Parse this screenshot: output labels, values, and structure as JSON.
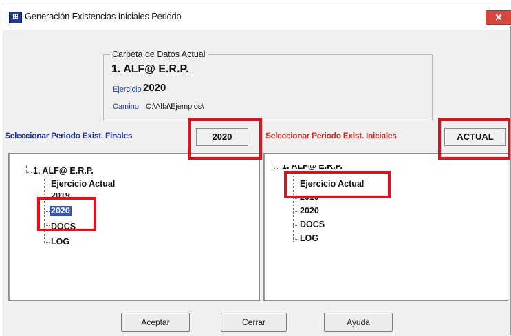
{
  "window": {
    "title": "Generación Existencias Iniciales Periodo",
    "app_icon_glyph": "⊞",
    "close_glyph": "✕"
  },
  "group": {
    "legend": "Carpeta de Datos Actual",
    "folder_name": "1. ALF@ E.R.P.",
    "ejercicio_label": "Ejercicio",
    "ejercicio_value": "2020",
    "camino_label": "Camino",
    "camino_value": "C:\\Alfa\\Ejemplos\\"
  },
  "selection": {
    "left_label": "Seleccionar Periodo Exist. Finales",
    "left_value": "2020",
    "right_label": "Seleccionar Periodo Exist. Iniciales",
    "right_value": "ACTUAL"
  },
  "left_tree": {
    "root": "1. ALF@ E.R.P.",
    "items": [
      "Ejercicio Actual",
      "2019",
      "2020",
      "DOCS",
      "LOG"
    ],
    "selected": "2020"
  },
  "right_tree": {
    "root": "1. ALF@ E.R.P.",
    "items": [
      "Ejercicio Actual",
      "2019",
      "2020",
      "DOCS",
      "LOG"
    ],
    "selected": "Ejercicio Actual"
  },
  "buttons": {
    "aceptar": "Aceptar",
    "cerrar": "Cerrar",
    "ayuda": "Ayuda"
  },
  "colors": {
    "highlight_red": "#e3101c",
    "label_blue": "#1c2fb0",
    "label_red": "#e0251c",
    "selection_blue": "#2f55c8"
  }
}
